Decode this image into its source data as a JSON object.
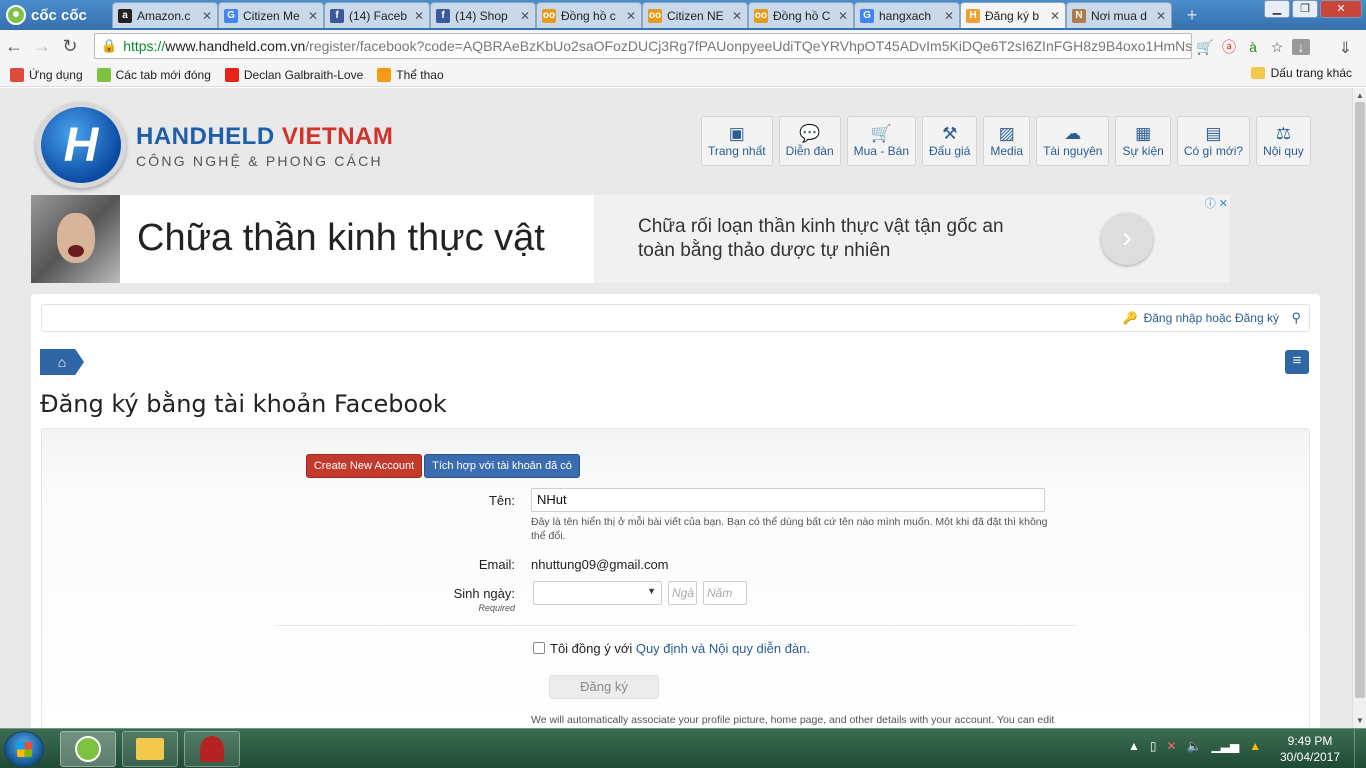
{
  "browser": {
    "brand": "cốc cốc",
    "tabs": [
      {
        "title": "Amazon.c",
        "fav_color": "#222",
        "fav_glyph": "a",
        "active": false
      },
      {
        "title": "Citizen Me",
        "fav_color": "#4285f4",
        "fav_glyph": "G",
        "active": false
      },
      {
        "title": "(14) Faceb",
        "fav_color": "#3b5998",
        "fav_glyph": "f",
        "active": false
      },
      {
        "title": "(14) Shop",
        "fav_color": "#3b5998",
        "fav_glyph": "f",
        "active": false
      },
      {
        "title": "Đồng hồ c",
        "fav_color": "#e59b1c",
        "fav_glyph": "oo",
        "active": false
      },
      {
        "title": "Citizen NE",
        "fav_color": "#e59b1c",
        "fav_glyph": "oo",
        "active": false
      },
      {
        "title": "Đồng hồ C",
        "fav_color": "#e59b1c",
        "fav_glyph": "oo",
        "active": false
      },
      {
        "title": "hangxach",
        "fav_color": "#4285f4",
        "fav_glyph": "G",
        "active": false
      },
      {
        "title": "Đăng ký b",
        "fav_color": "#f0a030",
        "fav_glyph": "H",
        "active": true
      },
      {
        "title": "Nơi mua d",
        "fav_color": "#b07a4a",
        "fav_glyph": "N",
        "active": false
      }
    ],
    "url": {
      "scheme": "https://",
      "host": "www.handheld.com.vn",
      "rest": "/register/facebook?code=AQBRAeBzKbUo2saOFozDUCj3Rg7fPAUonpyeeUdiTQeYRVhpOT45ADvIm5KiDQe6T2sI6ZInFGH8z9B4oxo1HmNsEoEE"
    },
    "bookmarks": [
      {
        "label": "Ứng dụng",
        "color": "#e04a3a"
      },
      {
        "label": "Các tab mới đóng",
        "color": "#7ec242"
      },
      {
        "label": "Declan Galbraith-Love",
        "color": "#e62117"
      },
      {
        "label": "Thể thao",
        "color": "#f39c12"
      }
    ],
    "other_bookmarks": "Dấu trang khác"
  },
  "site": {
    "logo_title_1": "HANDHELD",
    "logo_title_2": "VIETNAM",
    "logo_tagline": "CÔNG NGHỆ & PHONG CÁCH",
    "nav": [
      {
        "label": "Trang nhất",
        "icon": "home-icon"
      },
      {
        "label": "Diễn đàn",
        "icon": "chat-icon"
      },
      {
        "label": "Mua - Bán",
        "icon": "cart-icon"
      },
      {
        "label": "Đấu giá",
        "icon": "gavel-icon"
      },
      {
        "label": "Media",
        "icon": "image-icon"
      },
      {
        "label": "Tài nguyên",
        "icon": "cloud-download-icon"
      },
      {
        "label": "Sự kiện",
        "icon": "calendar-icon"
      },
      {
        "label": "Có gì mới?",
        "icon": "newspaper-icon"
      },
      {
        "label": "Nội quy",
        "icon": "scale-icon"
      }
    ],
    "ad": {
      "headline": "Chữa thần kinh thực vật",
      "description": "Chữa rối loạn thần kinh thực vật tận gốc an toàn bằng thảo dược tự nhiên"
    },
    "login_link": "Đăng nhập hoặc Đăng ký"
  },
  "form": {
    "page_title": "Đăng ký bằng tài khoản Facebook",
    "create_button": "Create New Account",
    "link_button": "Tích hợp với tài khoản đã có",
    "name_label": "Tên:",
    "name_value": "NHut",
    "name_hint": "Đây là tên hiển thị ở mỗi bài viết của bạn. Bạn có thể dùng bất cứ tên nào mình muốn. Một khi đã đặt thì không thể đổi.",
    "email_label": "Email:",
    "email_value": "nhuttung09@gmail.com",
    "dob_label": "Sinh ngày:",
    "dob_required": "Required",
    "day_placeholder": "Ngà",
    "year_placeholder": "Năm",
    "agree_prefix": "Tôi đồng ý với ",
    "agree_link": "Quy định và Nội quy diễn đàn",
    "agree_suffix": ".",
    "submit_button": "Đăng ký",
    "facebook_note": "We will automatically associate your profile picture, home page, and other details with your account. You can edit these after the account is created."
  },
  "taskbar": {
    "time": "9:49 PM",
    "date": "30/04/2017"
  }
}
